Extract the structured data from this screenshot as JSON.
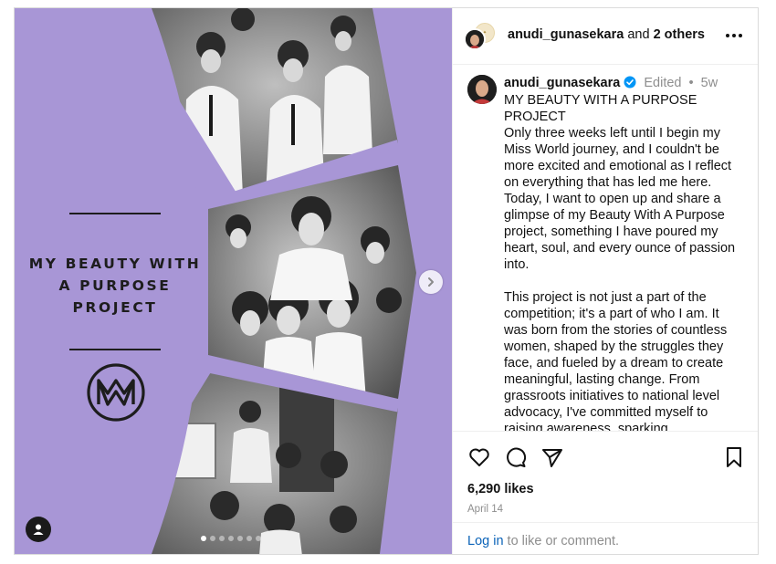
{
  "media": {
    "title": "MY BEAUTY WITH\nA PURPOSE\nPROJECT",
    "logo_icon": "miss-world-logo-icon",
    "next_icon": "chevron-right-icon",
    "tag_icon": "user-tag-icon",
    "carousel": {
      "total": 7,
      "active": 1
    },
    "background_color": "#a896d6"
  },
  "header": {
    "username": "anudi_gunasekara",
    "connector": "and",
    "others": "2 others",
    "more_icon": "more-horizontal-icon"
  },
  "caption": {
    "username": "anudi_gunasekara",
    "edited": "Edited",
    "separator": "•",
    "age": "5w",
    "text": "MY BEAUTY WITH A PURPOSE PROJECT\nOnly three weeks left until I begin my Miss World journey, and I couldn't be more excited and emotional as I reflect on everything that has led me here. Today, I want to open up and share a glimpse of my Beauty With A Purpose project, something I have poured my heart, soul, and every ounce of passion into.\n\nThis project is not just a part of the competition; it's a part of who I am. It was born from the stories of countless women, shaped by the struggles they face, and fueled by a dream to create meaningful, lasting change. From grassroots initiatives to national level advocacy, I've committed myself to raising awareness, sparking"
  },
  "actions": {
    "icons": [
      "heart-icon",
      "comment-icon",
      "share-icon",
      "bookmark-icon"
    ],
    "likes": "6,290 likes",
    "date": "April 14"
  },
  "footer": {
    "login": "Log in",
    "rest": "to like or comment."
  },
  "colors": {
    "accent_link": "#0b63b8",
    "verified_badge": "#0095f6",
    "muted_text": "#8e8e8e",
    "media_purple": "#a896d6"
  }
}
